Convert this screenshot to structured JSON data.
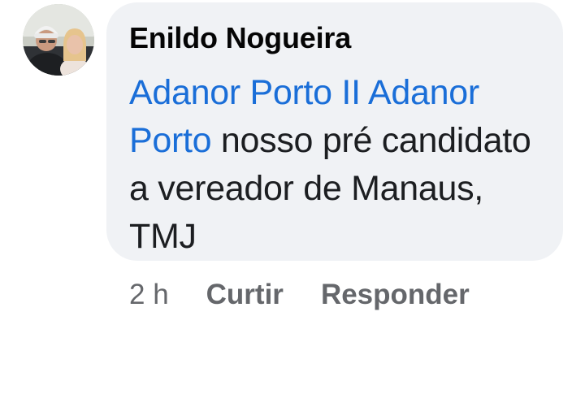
{
  "comment": {
    "author": "Enildo Nogueira",
    "body": {
      "mention_1": "Adanor Porto II",
      "mention_2": "Adanor Porto",
      "text": " nosso pré candidato a vereador de Manaus, TMJ"
    },
    "avatar_icon": "profile-photo-icon"
  },
  "actions": {
    "timestamp": "2 h",
    "like_label": "Curtir",
    "reply_label": "Responder"
  },
  "colors": {
    "bubble_bg": "#f0f2f5",
    "mention": "#1a6ed8",
    "meta_text": "#65676b"
  }
}
